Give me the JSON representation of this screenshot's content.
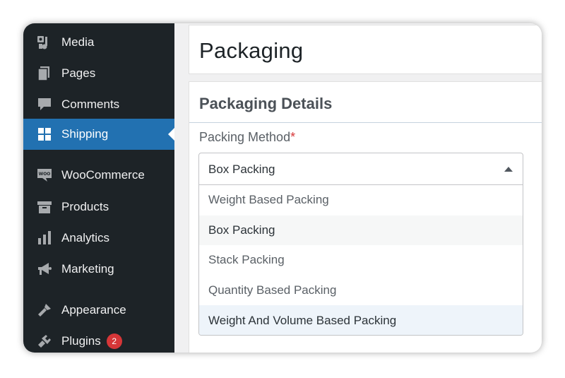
{
  "sidebar": {
    "items": [
      {
        "label": "Media",
        "icon": "media-icon"
      },
      {
        "label": "Pages",
        "icon": "pages-icon"
      },
      {
        "label": "Comments",
        "icon": "comments-icon"
      },
      {
        "label": "Shipping",
        "icon": "shipping-icon",
        "active": true
      },
      {
        "label": "WooCommerce",
        "icon": "woocommerce-icon"
      },
      {
        "label": "Products",
        "icon": "products-icon"
      },
      {
        "label": "Analytics",
        "icon": "analytics-icon"
      },
      {
        "label": "Marketing",
        "icon": "marketing-icon"
      },
      {
        "label": "Appearance",
        "icon": "appearance-icon"
      },
      {
        "label": "Plugins",
        "icon": "plugins-icon",
        "badge": "2"
      }
    ]
  },
  "header": {
    "title": "Packaging"
  },
  "details": {
    "section_title": "Packaging Details",
    "field_label": "Packing Method",
    "required_mark": "*",
    "select": {
      "value": "Box Packing",
      "options": [
        "Weight Based Packing",
        "Box Packing",
        "Stack Packing",
        "Quantity Based Packing",
        "Weight And Volume Based Packing"
      ]
    }
  },
  "colors": {
    "sidebar_bg": "#1d2327",
    "active_bg": "#2271b1",
    "badge_bg": "#d63638",
    "required": "#d63638"
  }
}
